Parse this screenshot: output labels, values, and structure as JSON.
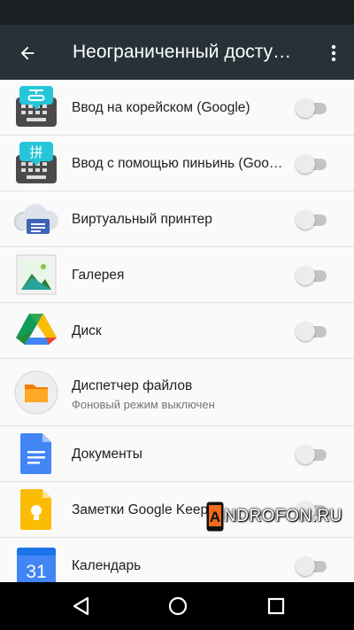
{
  "appbar": {
    "title": "Неограниченный досту…",
    "back_icon": "arrow-back-icon",
    "menu_icon": "more-vert-icon"
  },
  "apps": [
    {
      "label": "Ввод на корейском (Google)",
      "icon": "korean-keyboard-icon",
      "enabled": false
    },
    {
      "label": "Ввод с помощью пиньинь (Goo…",
      "icon": "pinyin-keyboard-icon",
      "icon_glyph": "拼",
      "enabled": false
    },
    {
      "label": "Виртуальный принтер",
      "icon": "cloud-printer-icon",
      "enabled": false
    },
    {
      "label": "Галерея",
      "icon": "gallery-icon",
      "enabled": false
    },
    {
      "label": "Диск",
      "icon": "google-drive-icon",
      "enabled": false
    },
    {
      "label": "Диспетчер файлов",
      "sublabel": "Фоновый режим выключен",
      "icon": "file-manager-icon"
    },
    {
      "label": "Документы",
      "icon": "google-docs-icon",
      "enabled": false
    },
    {
      "label": "Заметки Google Keep",
      "icon": "google-keep-icon",
      "enabled": false
    },
    {
      "label": "Календарь",
      "icon": "google-calendar-icon",
      "icon_number": "31",
      "enabled": false
    }
  ],
  "watermark": {
    "text": "NDROFON.RU",
    "logo_letter": "A"
  },
  "navbar": {
    "back_icon": "nav-back-icon",
    "home_icon": "nav-home-icon",
    "recents_icon": "nav-recents-icon"
  },
  "colors": {
    "appbar": "#263238",
    "statusbar": "#1c2124",
    "background": "#fafafa",
    "toggle_off_track": "#c4c4c4",
    "toggle_off_thumb": "#ececec",
    "watermark_accent": "#f26a1b"
  }
}
